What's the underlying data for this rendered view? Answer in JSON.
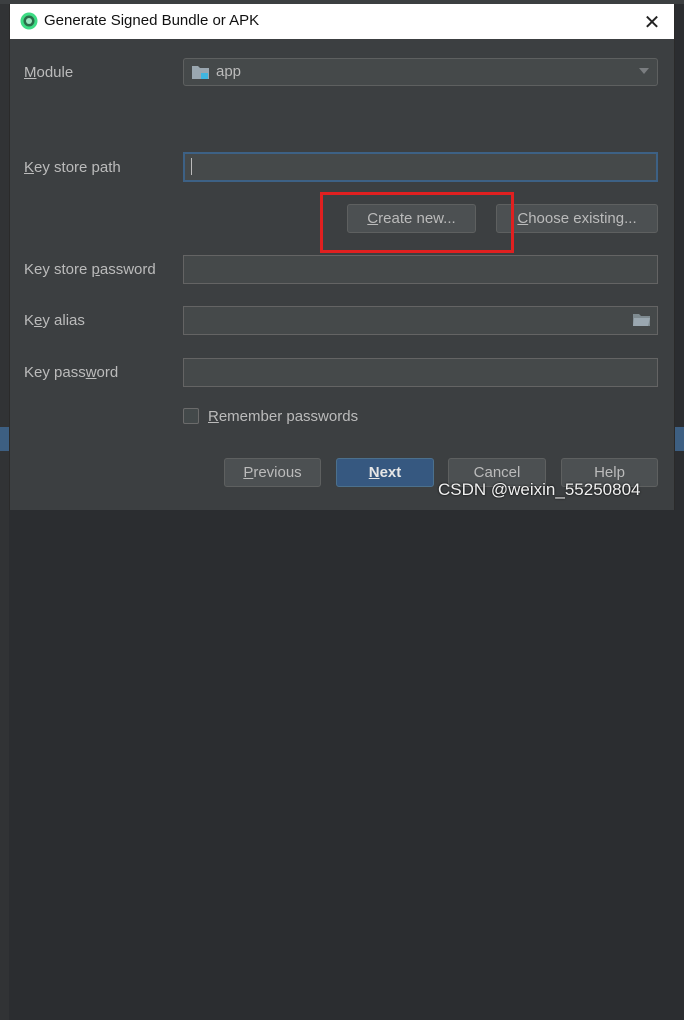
{
  "dialog": {
    "title": "Generate Signed Bundle or APK",
    "close_glyph": "✕",
    "title_icon": "android-studio-icon"
  },
  "module": {
    "label_pre": "",
    "label_u": "M",
    "label_post": "odule",
    "value": "app",
    "icon": "module-folder-icon"
  },
  "keystore": {
    "label_pre": "",
    "label_u": "K",
    "label_post": "ey store path",
    "value": "",
    "create_pre": "",
    "create_u": "C",
    "create_post": "reate new...",
    "choose_pre": "",
    "choose_u": "C",
    "choose_post": "hoose existing..."
  },
  "keystore_password": {
    "label_pre": "Key store ",
    "label_u": "p",
    "label_post": "assword"
  },
  "key_alias": {
    "label_pre": "K",
    "label_u": "e",
    "label_post": "y alias",
    "icon": "folder-icon"
  },
  "key_password": {
    "label_pre": "Key pass",
    "label_u": "w",
    "label_post": "ord"
  },
  "remember": {
    "label_pre": "",
    "label_u": "R",
    "label_post": "emember passwords",
    "checked": false
  },
  "buttons": {
    "previous_pre": "",
    "previous_u": "P",
    "previous_post": "revious",
    "next_pre": "",
    "next_u": "N",
    "next_post": "ext",
    "cancel": "Cancel",
    "help": "Help"
  },
  "watermark": "CSDN @weixin_55250804",
  "colors": {
    "background": "#3c3f41",
    "field": "#45494a",
    "primary_button": "#365880",
    "highlight": "#e02020"
  }
}
